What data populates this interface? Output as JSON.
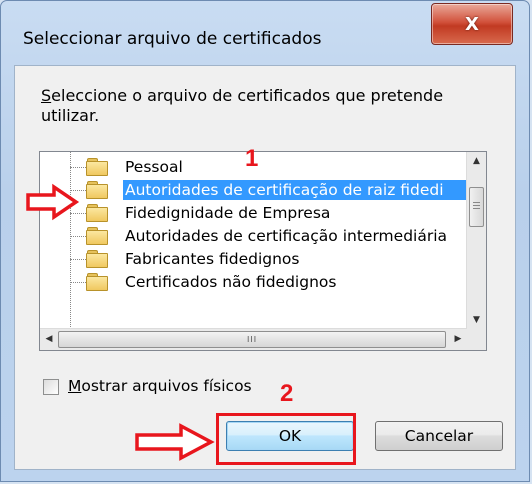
{
  "window": {
    "title": "Seleccionar arquivo de certificados",
    "close_label": "X"
  },
  "dialog": {
    "prompt_accel": "S",
    "prompt_rest": "eleccione o arquivo de certificados que pretende utilizar.",
    "tree_items": [
      {
        "label": "Pessoal",
        "selected": false
      },
      {
        "label": "Autoridades de certificação de raiz fidedi",
        "selected": true
      },
      {
        "label": "Fidedignidade de Empresa",
        "selected": false
      },
      {
        "label": "Autoridades de certificação intermediária",
        "selected": false
      },
      {
        "label": "Fabricantes fidedignos",
        "selected": false
      },
      {
        "label": "Certificados não fidedignos",
        "selected": false
      }
    ],
    "show_physical_accel": "M",
    "show_physical_rest": "ostrar arquivos físicos",
    "show_physical_checked": false,
    "ok_label": "OK",
    "cancel_label": "Cancelar"
  },
  "annotations": {
    "step1": "1",
    "step2": "2",
    "color": "#e8161d"
  },
  "scroll": {
    "h_grip": "III",
    "up": "▲",
    "down": "▼",
    "left": "◀",
    "right": "▶"
  }
}
